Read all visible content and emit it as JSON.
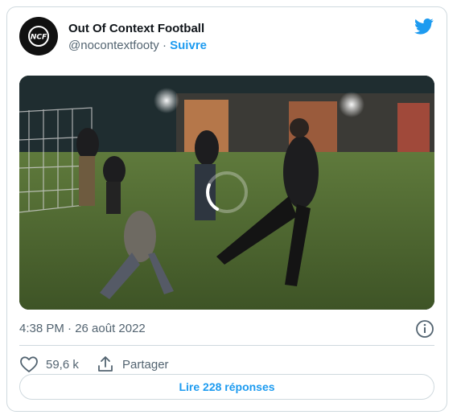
{
  "account": {
    "display_name": "Out Of Context Football",
    "handle": "@nocontextfooty",
    "separator": " · ",
    "follow_label": "Suivre",
    "avatar_text": "NCF"
  },
  "tweet": {
    "timestamp": "4:38 PM · 26 août 2022"
  },
  "actions": {
    "likes_count": "59,6 k",
    "share_label": "Partager",
    "replies_button": "Lire 228 réponses"
  },
  "colors": {
    "accent": "#1d9bf0",
    "text": "#0f1419",
    "muted": "#536471",
    "border": "#cfd9de"
  },
  "icons": [
    "twitter-bird-icon",
    "info-icon",
    "heart-icon",
    "share-icon",
    "loading-spinner-icon"
  ]
}
